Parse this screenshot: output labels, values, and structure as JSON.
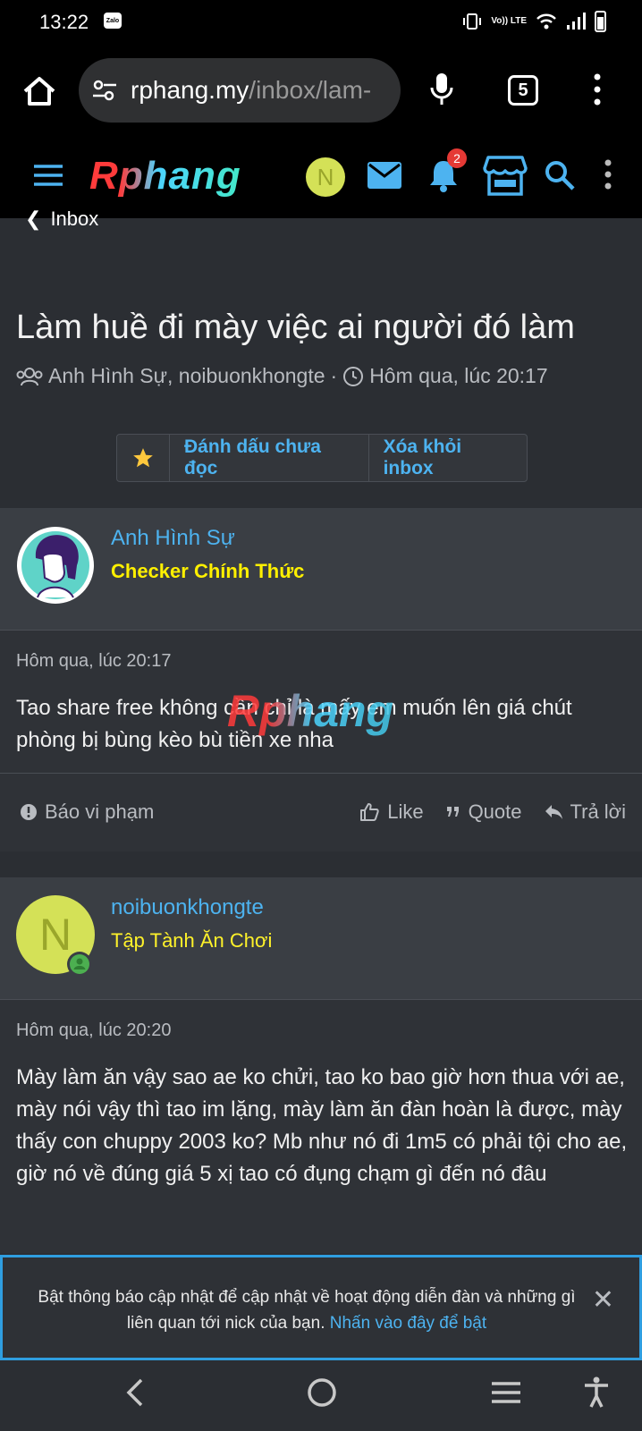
{
  "status_bar": {
    "time": "13:22",
    "zalo": "Zalo",
    "lte": "Vo)) LTE"
  },
  "browser": {
    "url_host": "rphang.my",
    "url_path": "/inbox/lam-",
    "tab_count": "5"
  },
  "site": {
    "logo": "Rphang",
    "avatar_letter": "N",
    "alerts_count": "2"
  },
  "breadcrumb": "Inbox",
  "conversation": {
    "title": "Làm huề đi mày việc ai người đó làm",
    "participants": "Anh Hình Sự, noibuonkhongte",
    "separator": "·",
    "time": "Hôm qua, lúc 20:17",
    "actions": {
      "mark_unread": "Đánh dấu chưa đọc",
      "remove": "Xóa khỏi inbox"
    }
  },
  "messages": [
    {
      "author": "Anh Hình Sự",
      "user_title": "Checker Chính Thức",
      "date": "Hôm qua, lúc 20:17",
      "body": "Tao share free không cần chỉ là mấy em muốn lên giá chút phòng bị bùng kèo bù tiền xe nha",
      "report": "Báo vi phạm",
      "like": "Like",
      "quote": "Quote",
      "reply": "Trả lời"
    },
    {
      "author": "noibuonkhongte",
      "avatar_letter": "N",
      "user_title": "Tập Tành Ăn Chơi",
      "date": "Hôm qua, lúc 20:20",
      "body": "Mày làm ăn vậy sao ae ko chửi, tao ko bao giờ hơn thua với ae, mày nói vậy thì tao im lặng, mày làm ăn đàn hoàn là được, mày thấy con chuppy 2003 ko? Mb như nó đi 1m5 có phải tội cho ae, giờ nó về đúng giá 5 xị tao có đụng chạm gì đến nó đâu"
    }
  ],
  "watermark": "Rphang",
  "notice": {
    "text": "Bật thông báo cập nhật để cập nhật về hoạt động diễn đàn và những gì liên quan tới nick của bạn.",
    "link": "Nhấn vào đây để bật",
    "close": "✕"
  },
  "colors": {
    "accent": "#4db3f0",
    "user_title_yellow": "#fff000",
    "avatar_green": "#d4e157",
    "notice_border": "#2f9ee0"
  }
}
